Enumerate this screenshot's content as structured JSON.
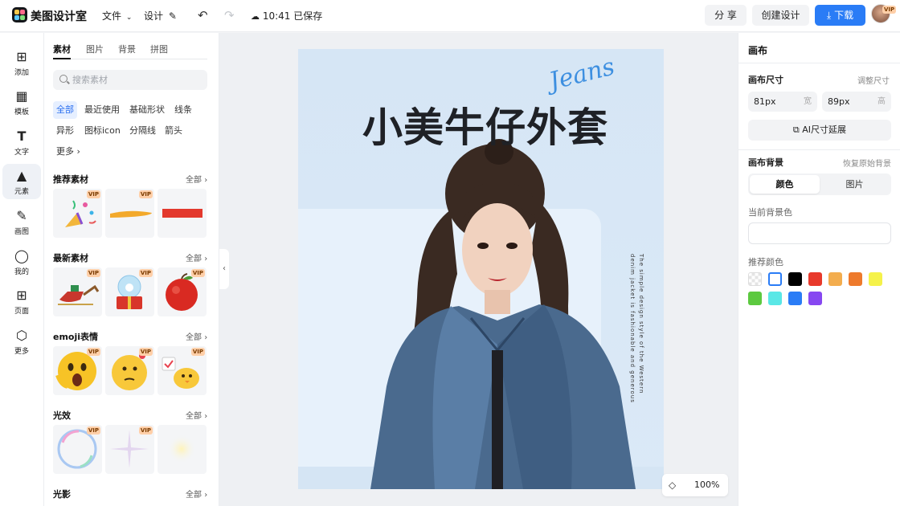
{
  "header": {
    "app_name": "美图设计室",
    "menu_file": "文件",
    "menu_design": "设计",
    "save_status": "10:41 已保存",
    "share_label": "分 享",
    "create_label": "创建设计",
    "download_label": "下载",
    "vip_label": "VIP"
  },
  "toolbar": {
    "items": [
      {
        "label": "添加",
        "icon": "plus-square-icon"
      },
      {
        "label": "模板",
        "icon": "template-icon"
      },
      {
        "label": "文字",
        "icon": "text-icon"
      },
      {
        "label": "元素",
        "icon": "element-drop-icon"
      },
      {
        "label": "画图",
        "icon": "draw-icon"
      },
      {
        "label": "我的",
        "icon": "user-icon"
      },
      {
        "label": "页面",
        "icon": "page-icon"
      },
      {
        "label": "更多",
        "icon": "cube-icon"
      }
    ],
    "active": "元素"
  },
  "panel": {
    "tabs": [
      "素材",
      "图片",
      "背景",
      "拼图"
    ],
    "search_placeholder": "搜索素材",
    "chips": [
      "全部",
      "最近使用",
      "基础形状",
      "线条",
      "异形",
      "图标icon",
      "分隔线",
      "箭头",
      "更多"
    ],
    "sections": [
      {
        "title": "推荐素材",
        "all": "全部"
      },
      {
        "title": "最新素材",
        "all": "全部"
      },
      {
        "title": "emoji表情",
        "all": "全部"
      },
      {
        "title": "光效",
        "all": "全部"
      },
      {
        "title": "光影",
        "all": "全部"
      }
    ],
    "vip_label": "VIP"
  },
  "canvas": {
    "headline": "小美牛仔外套",
    "script_title": "Jeans",
    "side_text": "The simple design style of the Western denim jacket is fashionable and generous"
  },
  "zoom": {
    "value": "100%"
  },
  "properties": {
    "title": "画布",
    "size_label": "画布尺寸",
    "adjust_size": "调整尺寸",
    "width_value": "81px",
    "width_unit": "宽",
    "height_value": "89px",
    "height_unit": "高",
    "ai_extend": "AI尺寸延展",
    "bg_label": "画布背景",
    "restore_bg": "恢复原始背景",
    "seg_color": "颜色",
    "seg_image": "图片",
    "current_bg_label": "当前背景色",
    "recommended_label": "推荐颜色",
    "swatches": [
      "transparent",
      "#ffffff",
      "#000000",
      "#e8392b",
      "#f3ad4e",
      "#ee7a2c",
      "#f5f24a",
      "#5cc93f",
      "#5ae7e6",
      "#2a7cf6",
      "#8747f1"
    ]
  }
}
